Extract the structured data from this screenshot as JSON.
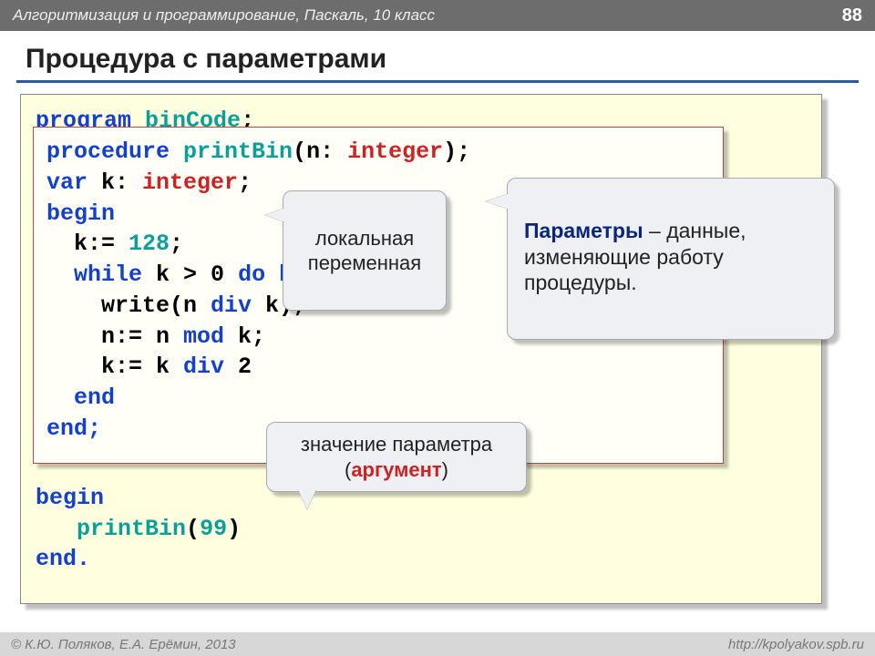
{
  "header": {
    "course": "Алгоритмизация и программирование, Паскаль, 10 класс",
    "page": "88"
  },
  "title": "Процедура с параметрами",
  "outer_code": {
    "l1_kw": "program ",
    "l1_id": "binCode",
    "l1_sc": ";",
    "l_begin": "begin",
    "call_indent": "   ",
    "call_name": "printBin",
    "call_open": "(",
    "call_arg": "99",
    "call_close": ")",
    "l_end": "end."
  },
  "inner_code": {
    "r1_kw": "procedure ",
    "r1_id": "printBin",
    "r1_p1": "(n: ",
    "r1_ty": "integer",
    "r1_p2": ");",
    "r2_kw": "var ",
    "r2_txt": "k: ",
    "r2_ty": "integer",
    "r2_sc": ";",
    "r3": "begin",
    "r4a": "  k:= ",
    "r4b": "128",
    "r4c": ";",
    "r5_pre": "  ",
    "r5_kw1": "while",
    "r5_mid": " k > 0 ",
    "r5_kw2": "do begin",
    "r6": "    write(n ",
    "r6_kw": "div",
    "r6_b": " k);",
    "r7": "    n:= n ",
    "r7_kw": "mod",
    "r7_b": " k;",
    "r8": "    k:= k ",
    "r8_kw": "div",
    "r8_b": " 2",
    "r9_indent": "  ",
    "r9": "end",
    "r10": "end;"
  },
  "callouts": {
    "local_var": "локальная\nпеременная",
    "params_b": "Параметры",
    "params_rest": " – данные,\nизменяющие работу\nпроцедуры.",
    "arg_top": "значение параметра",
    "arg_open": "(",
    "arg_word": "аргумент",
    "arg_close": ")"
  },
  "footer": {
    "left": "© К.Ю. Поляков, Е.А. Ерёмин, 2013",
    "right": "http://kpolyakov.spb.ru"
  }
}
